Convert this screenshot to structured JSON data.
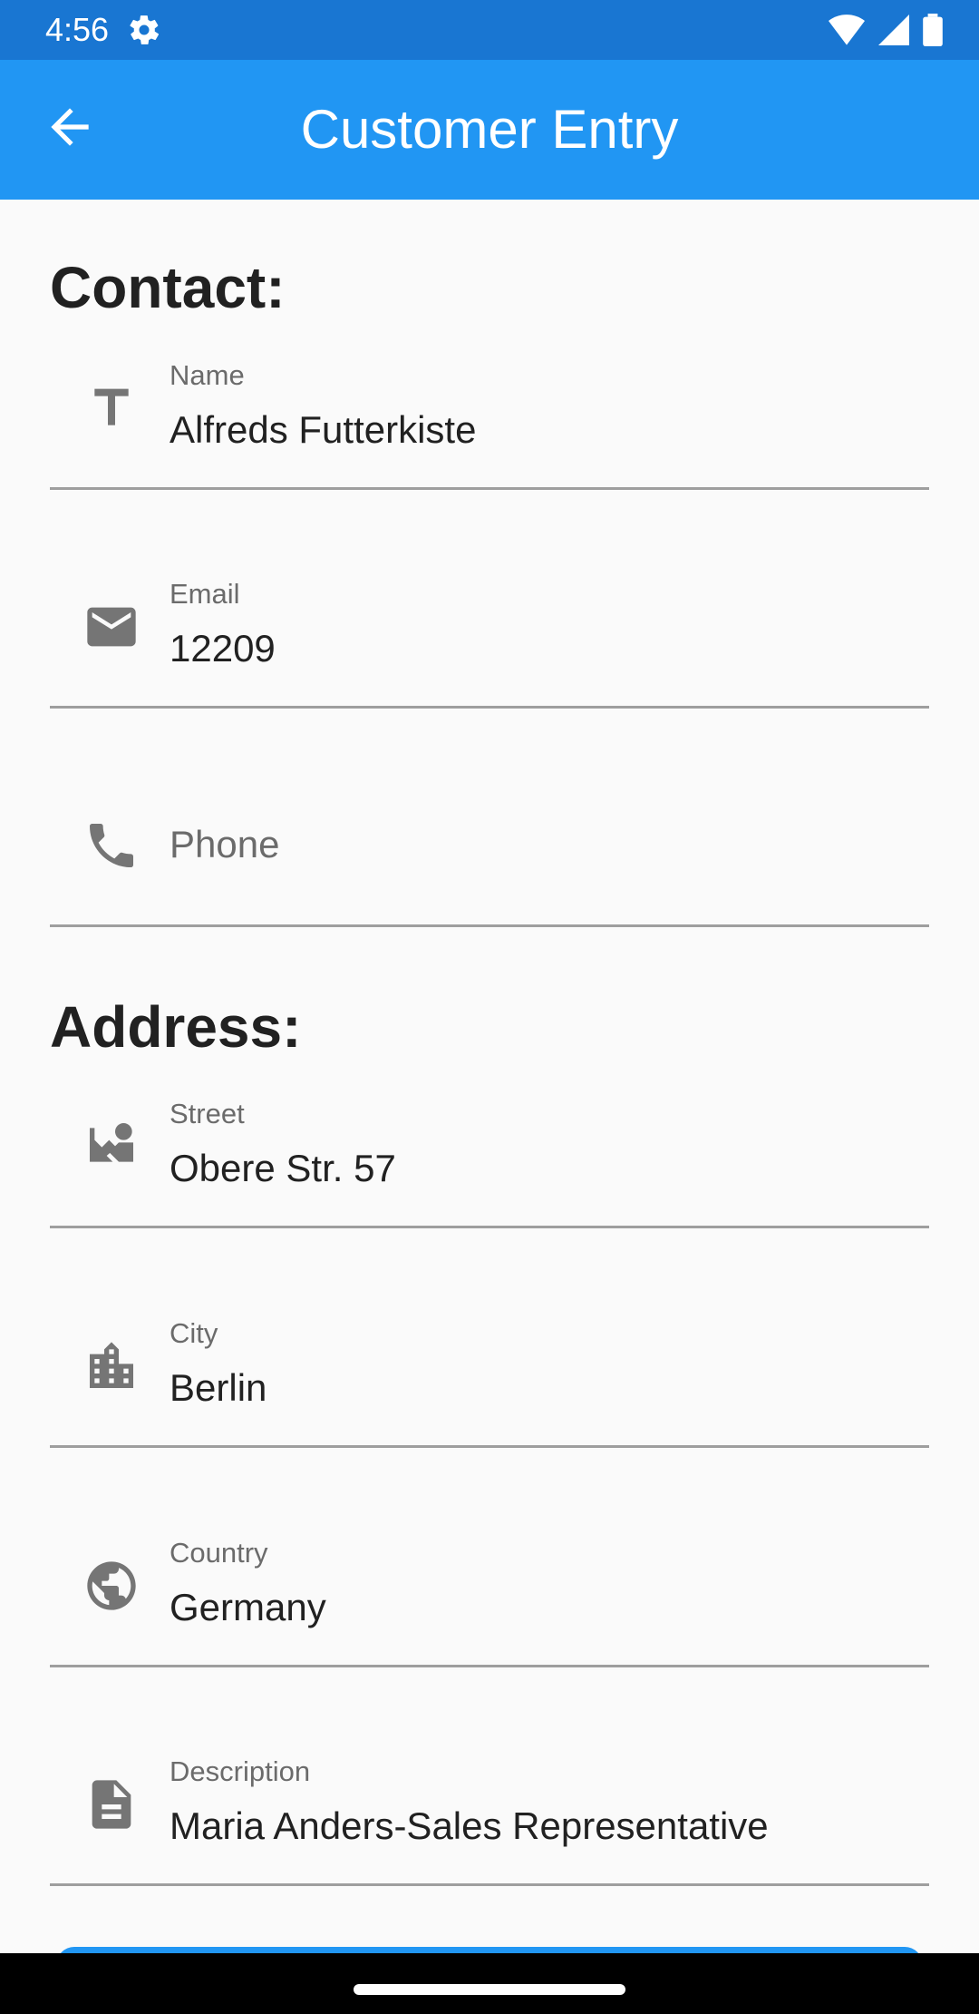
{
  "status_bar": {
    "time": "4:56"
  },
  "app_bar": {
    "title": "Customer Entry"
  },
  "sections": {
    "contact_heading": "Contact:",
    "address_heading": "Address:"
  },
  "fields": {
    "name": {
      "label": "Name",
      "value": "Alfreds Futterkiste",
      "icon": "text-icon"
    },
    "email": {
      "label": "Email",
      "value": "12209",
      "icon": "mail-icon"
    },
    "phone": {
      "placeholder": "Phone",
      "value": "",
      "icon": "phone-icon"
    },
    "street": {
      "label": "Street",
      "value": "Obere Str. 57",
      "icon": "street-map-icon"
    },
    "city": {
      "label": "City",
      "value": "Berlin",
      "icon": "city-icon"
    },
    "country": {
      "label": "Country",
      "value": "Germany",
      "icon": "globe-icon"
    },
    "description": {
      "label": "Description",
      "value": "Maria Anders-Sales Representative",
      "icon": "document-icon"
    }
  },
  "colors": {
    "status_bar": "#1976d2",
    "app_bar": "#2196f3",
    "icon_gray": "#757575"
  }
}
